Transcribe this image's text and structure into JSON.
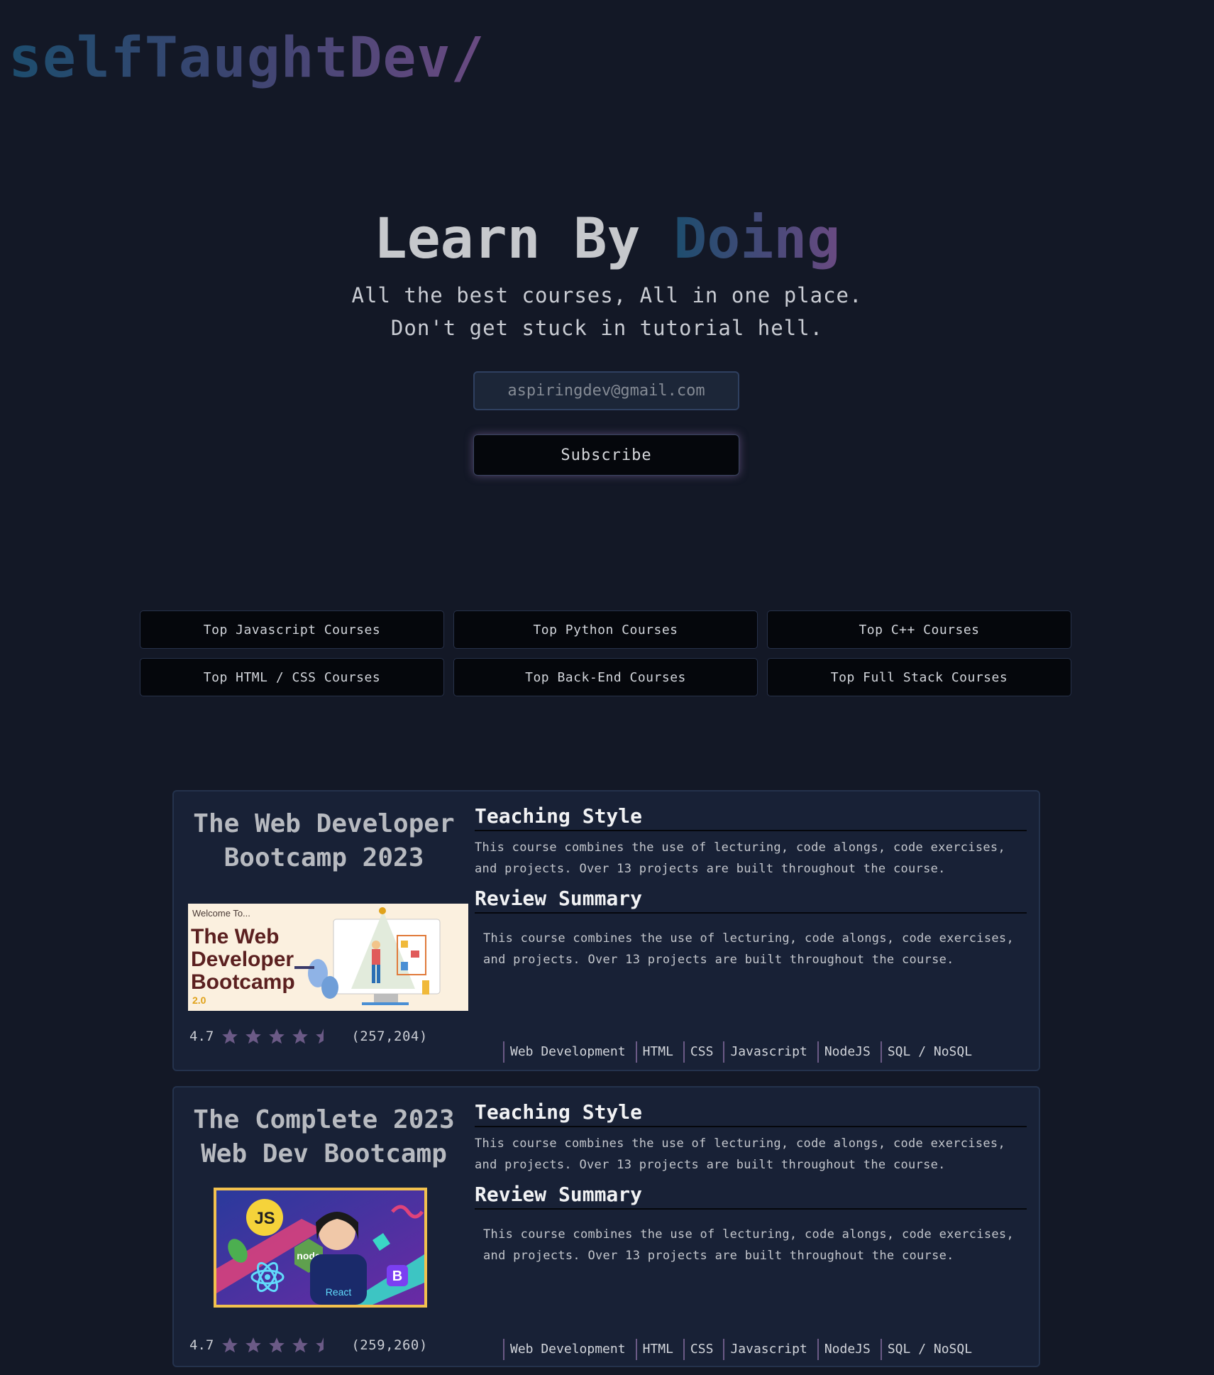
{
  "header": {
    "logo": "selfTaughtDev/"
  },
  "hero": {
    "title_plain": "Learn By ",
    "title_accent": "Doing",
    "subtitle_line1": "All the best courses, All in one place.",
    "subtitle_line2": "Don't get stuck in tutorial hell."
  },
  "subscribe": {
    "email_placeholder": "aspiringdev@gmail.com",
    "button_label": "Subscribe"
  },
  "categories": [
    {
      "label": "Top Javascript Courses"
    },
    {
      "label": "Top Python Courses"
    },
    {
      "label": "Top C++ Courses"
    },
    {
      "label": "Top HTML / CSS Courses"
    },
    {
      "label": "Top Back-End Courses"
    },
    {
      "label": "Top Full Stack Courses"
    }
  ],
  "courses": [
    {
      "title_line1": "The Web Developer",
      "title_line2": "Bootcamp 2023",
      "thumbnail": {
        "welcome": "Welcome To...",
        "line1": "The Web",
        "line2": "Developer",
        "line3": "Bootcamp",
        "version": "2.0"
      },
      "rating": "4.7",
      "stars": 4.5,
      "review_count": "(257,204)",
      "teaching_style_heading": "Teaching Style",
      "teaching_style_text": "This course combines the use of lecturing, code alongs, code exercises, and projects. Over 13 projects are built throughout the course.",
      "review_summary_heading": "Review Summary",
      "review_summary_text": "This course combines the use of lecturing, code alongs, code exercises, and projects. Over 13 projects are built throughout the course.",
      "tags": [
        "Web Development",
        "HTML",
        "CSS",
        "Javascript",
        "NodeJS",
        "SQL / NoSQL"
      ]
    },
    {
      "title_line1": "The Complete 2023",
      "title_line2": "Web Dev Bootcamp",
      "thumbnail": {
        "badge_js": "JS",
        "badge_node": "node",
        "badge_b": "B",
        "badge_react": "React"
      },
      "rating": "4.7",
      "stars": 4.5,
      "review_count": "(259,260)",
      "teaching_style_heading": "Teaching Style",
      "teaching_style_text": "This course combines the use of lecturing, code alongs, code exercises, and projects. Over 13 projects are built throughout the course.",
      "review_summary_heading": "Review Summary",
      "review_summary_text": "This course combines the use of lecturing, code alongs, code exercises, and projects. Over 13 projects are built throughout the course.",
      "tags": [
        "Web Development",
        "HTML",
        "CSS",
        "Javascript",
        "NodeJS",
        "SQL / NoSQL"
      ]
    }
  ],
  "colors": {
    "background": "#131826",
    "card": "#182136",
    "star": "#6b5a86",
    "button": "#05070c"
  }
}
